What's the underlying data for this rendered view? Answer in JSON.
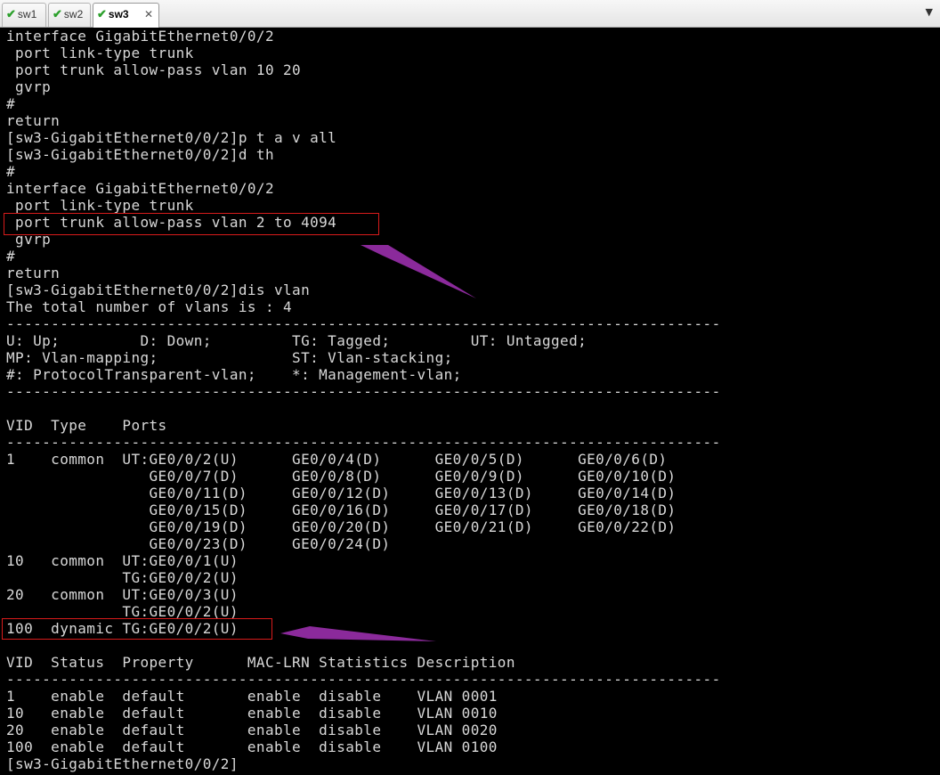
{
  "tabs": [
    {
      "label": "sw1",
      "active": false
    },
    {
      "label": "sw2",
      "active": false
    },
    {
      "label": "sw3",
      "active": true
    }
  ],
  "tab_close_glyph": "✕",
  "check_glyph": "✔",
  "dropdown_glyph": "▼",
  "terminal": {
    "text_color": "#d8d8d8",
    "highlight_color": "#d81b1b",
    "arrow_color": "#8b2a9b",
    "lines": [
      "interface GigabitEthernet0/0/2",
      " port link-type trunk",
      " port trunk allow-pass vlan 10 20",
      " gvrp",
      "#",
      "return",
      "[sw3-GigabitEthernet0/0/2]p t a v all",
      "[sw3-GigabitEthernet0/0/2]d th",
      "#",
      "interface GigabitEthernet0/0/2",
      " port link-type trunk",
      " port trunk allow-pass vlan 2 to 4094",
      " gvrp",
      "#",
      "return",
      "[sw3-GigabitEthernet0/0/2]dis vlan",
      "The total number of vlans is : 4",
      "--------------------------------------------------------------------------------",
      "U: Up;         D: Down;         TG: Tagged;         UT: Untagged;",
      "MP: Vlan-mapping;               ST: Vlan-stacking;",
      "#: ProtocolTransparent-vlan;    *: Management-vlan;",
      "--------------------------------------------------------------------------------",
      "",
      "VID  Type    Ports",
      "--------------------------------------------------------------------------------",
      "1    common  UT:GE0/0/2(U)      GE0/0/4(D)      GE0/0/5(D)      GE0/0/6(D)",
      "                GE0/0/7(D)      GE0/0/8(D)      GE0/0/9(D)      GE0/0/10(D)",
      "                GE0/0/11(D)     GE0/0/12(D)     GE0/0/13(D)     GE0/0/14(D)",
      "                GE0/0/15(D)     GE0/0/16(D)     GE0/0/17(D)     GE0/0/18(D)",
      "                GE0/0/19(D)     GE0/0/20(D)     GE0/0/21(D)     GE0/0/22(D)",
      "                GE0/0/23(D)     GE0/0/24(D)",
      "10   common  UT:GE0/0/1(U)",
      "             TG:GE0/0/2(U)",
      "20   common  UT:GE0/0/3(U)",
      "             TG:GE0/0/2(U)",
      "100  dynamic TG:GE0/0/2(U)",
      "",
      "VID  Status  Property      MAC-LRN Statistics Description",
      "--------------------------------------------------------------------------------",
      "1    enable  default       enable  disable    VLAN 0001",
      "10   enable  default       enable  disable    VLAN 0010",
      "20   enable  default       enable  disable    VLAN 0020",
      "100  enable  default       enable  disable    VLAN 0100",
      "[sw3-GigabitEthernet0/0/2]"
    ]
  }
}
